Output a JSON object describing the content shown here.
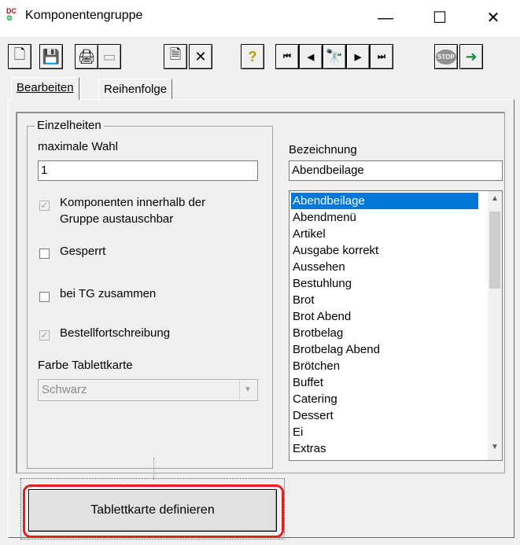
{
  "window": {
    "title": "Komponentengruppe",
    "minimize": "—",
    "maximize": "☐",
    "close": "✕"
  },
  "toolbar": {
    "new": "🗋",
    "save": "💾",
    "print": "🖨",
    "print_disabled": "▭",
    "properties": "🗎",
    "delete": "✕",
    "help": "?",
    "first": "⏮",
    "prev": "◀",
    "search": "🔭",
    "next": "▶",
    "last": "⏭",
    "stop": "STOP",
    "exit": "➜"
  },
  "tabs": [
    "Bearbeiten",
    "Reihenfolge"
  ],
  "details": {
    "group_title": "Einzelheiten",
    "max_choice_label": "maximale Wahl",
    "max_choice_value": "1",
    "exchangeable_label_1": "Komponenten innerhalb der",
    "exchangeable_label_2": "Gruppe austauschbar",
    "exchangeable_checked": "✓",
    "locked_label": "Gesperrt",
    "tg_together_label": "bei TG zusammen",
    "order_update_label": "Bestellfortschreibung",
    "order_update_checked": "✓",
    "tray_color_label": "Farbe Tablettkarte",
    "tray_color_value": "Schwarz"
  },
  "designation": {
    "label": "Bezeichnung",
    "value": "Abendbeilage",
    "items": [
      "Abendbeilage",
      "Abendmenü",
      "Artikel",
      "Ausgabe korrekt",
      "Aussehen",
      "Bestuhlung",
      "Brot",
      "Brot Abend",
      "Brotbelag",
      "Brotbelag Abend",
      "Brötchen",
      "Buffet",
      "Catering",
      "Dessert",
      "Ei",
      "Extras"
    ],
    "selected_index": 0
  },
  "define_button": "Tablettkarte definieren",
  "colors": {
    "selection": "#0078d7",
    "highlight": "#e02020"
  }
}
